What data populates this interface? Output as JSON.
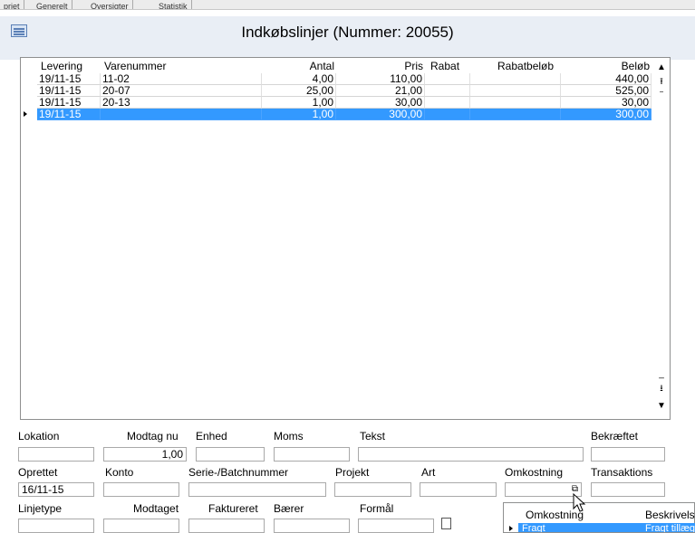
{
  "tabs": [
    "priet",
    "Generelt",
    "Oversigter",
    "Statistik"
  ],
  "window": {
    "title": "Indkøbslinjer (Nummer: 20055)"
  },
  "grid": {
    "headers": [
      "Levering",
      "Varenummer",
      "Antal",
      "Pris",
      "Rabat",
      "Rabatbeløb",
      "Beløb"
    ],
    "rows": [
      {
        "levering": "19/11-15",
        "varenummer": "11-02",
        "antal": "4,00",
        "pris": "110,00",
        "rabat": "",
        "rabatbelob": "",
        "belob": "440,00"
      },
      {
        "levering": "19/11-15",
        "varenummer": "20-07",
        "antal": "25,00",
        "pris": "21,00",
        "rabat": "",
        "rabatbelob": "",
        "belob": "525,00"
      },
      {
        "levering": "19/11-15",
        "varenummer": "20-13",
        "antal": "1,00",
        "pris": "30,00",
        "rabat": "",
        "rabatbelob": "",
        "belob": "30,00"
      },
      {
        "levering": "19/11-15",
        "varenummer": "",
        "antal": "1,00",
        "pris": "300,00",
        "rabat": "",
        "rabatbelob": "",
        "belob": "300,00"
      }
    ],
    "selected_row": 3
  },
  "form": {
    "row1": {
      "lokation": "Lokation",
      "modtag_nu": "Modtag nu",
      "modtag_nu_value": "1,00",
      "enhed": "Enhed",
      "moms": "Moms",
      "tekst": "Tekst",
      "bekraeftet": "Bekræftet"
    },
    "row2": {
      "oprettet": "Oprettet",
      "oprettet_value": "16/11-15",
      "konto": "Konto",
      "serie": "Serie-/Batchnummer",
      "projekt": "Projekt",
      "art": "Art",
      "omkostning": "Omkostning",
      "transaktions": "Transaktions"
    },
    "row3": {
      "linjetype": "Linjetype",
      "modtaget": "Modtaget",
      "faktureret": "Faktureret",
      "baerer": "Bærer",
      "formal": "Formål"
    }
  },
  "popup": {
    "headers": [
      "Omkostning",
      "Beskrivels"
    ],
    "row": {
      "omkostning": "Fragt",
      "beskrivelse": "Fragt tillæg"
    }
  }
}
